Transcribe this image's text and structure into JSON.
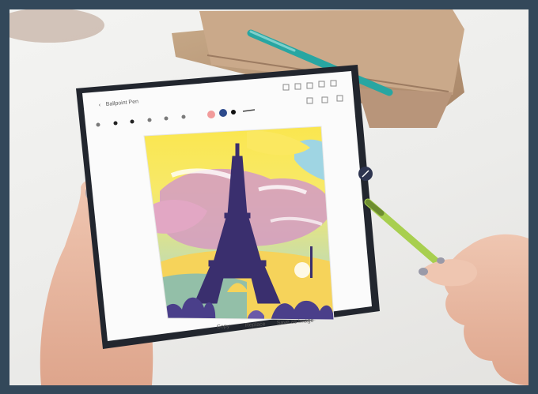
{
  "screen": {
    "title": "Ballpoint Pen",
    "actions": [
      "Copy",
      "Replace",
      "Save as Image"
    ]
  },
  "colors": {
    "border": "#33485a",
    "pen": "#a8cf4f",
    "tablet": "#22262e"
  }
}
